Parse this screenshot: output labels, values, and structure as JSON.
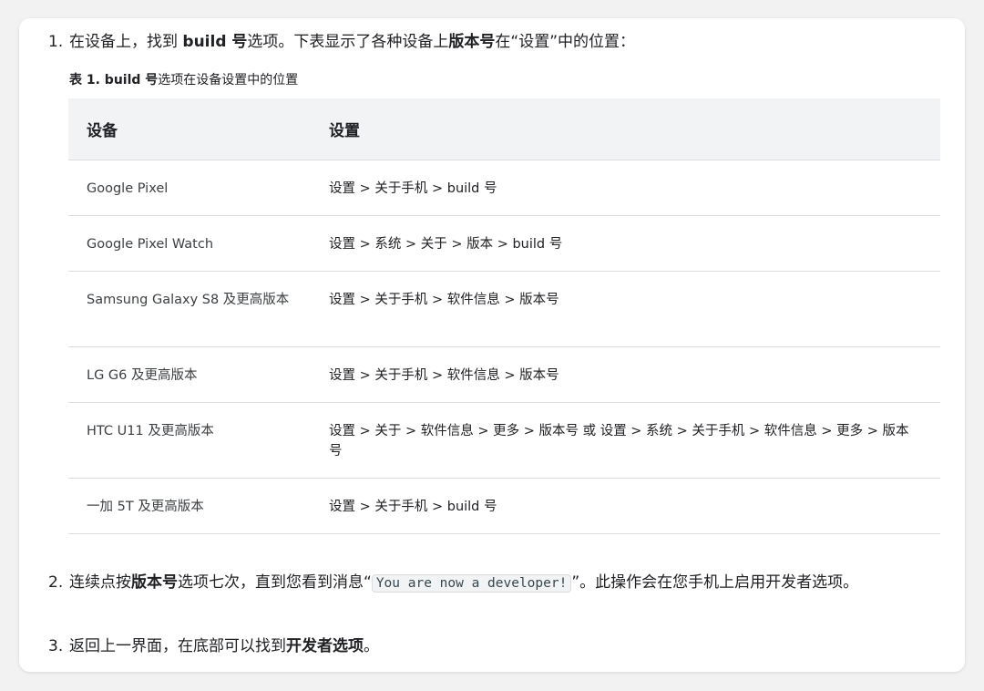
{
  "step1": {
    "num": "1.",
    "t1": "在设备上，找到 ",
    "b1": "build 号",
    "t2": "选项。下表显示了各种设备上",
    "b2": "版本号",
    "t3": "在“设置”中的位置："
  },
  "caption": {
    "bold": "表 1. build 号",
    "rest": "选项在设备设置中的位置"
  },
  "table": {
    "headers": [
      "设备",
      "设置"
    ],
    "rows": [
      {
        "device": "Google Pixel",
        "path": "设置 > 关于手机 > build 号"
      },
      {
        "device": "Google Pixel Watch",
        "path": "设置 > 系统 > 关于 > 版本 > build 号"
      },
      {
        "device": "Samsung Galaxy S8 及更高版本",
        "path": "设置 > 关于手机 > 软件信息 > 版本号"
      },
      {
        "device": "LG G6 及更高版本",
        "path": "设置 > 关于手机 > 软件信息 > 版本号"
      },
      {
        "device": "HTC U11 及更高版本",
        "path": "设置 > 关于 > 软件信息 > 更多 > 版本号 或 设置 > 系统 > 关于手机 > 软件信息 > 更多 > 版本号"
      },
      {
        "device": "一加 5T 及更高版本",
        "path": "设置 > 关于手机 > build 号"
      }
    ]
  },
  "step2": {
    "num": "2.",
    "t1": "连续点按",
    "b1": "版本号",
    "t2": "选项七次，直到您看到消息“",
    "code": "You are now a developer!",
    "t3": "”。此操作会在您手机上启用开发者选项。"
  },
  "step3": {
    "num": "3.",
    "t1": "返回上一界面，在底部可以找到",
    "b1": "开发者选项",
    "t2": "。"
  }
}
